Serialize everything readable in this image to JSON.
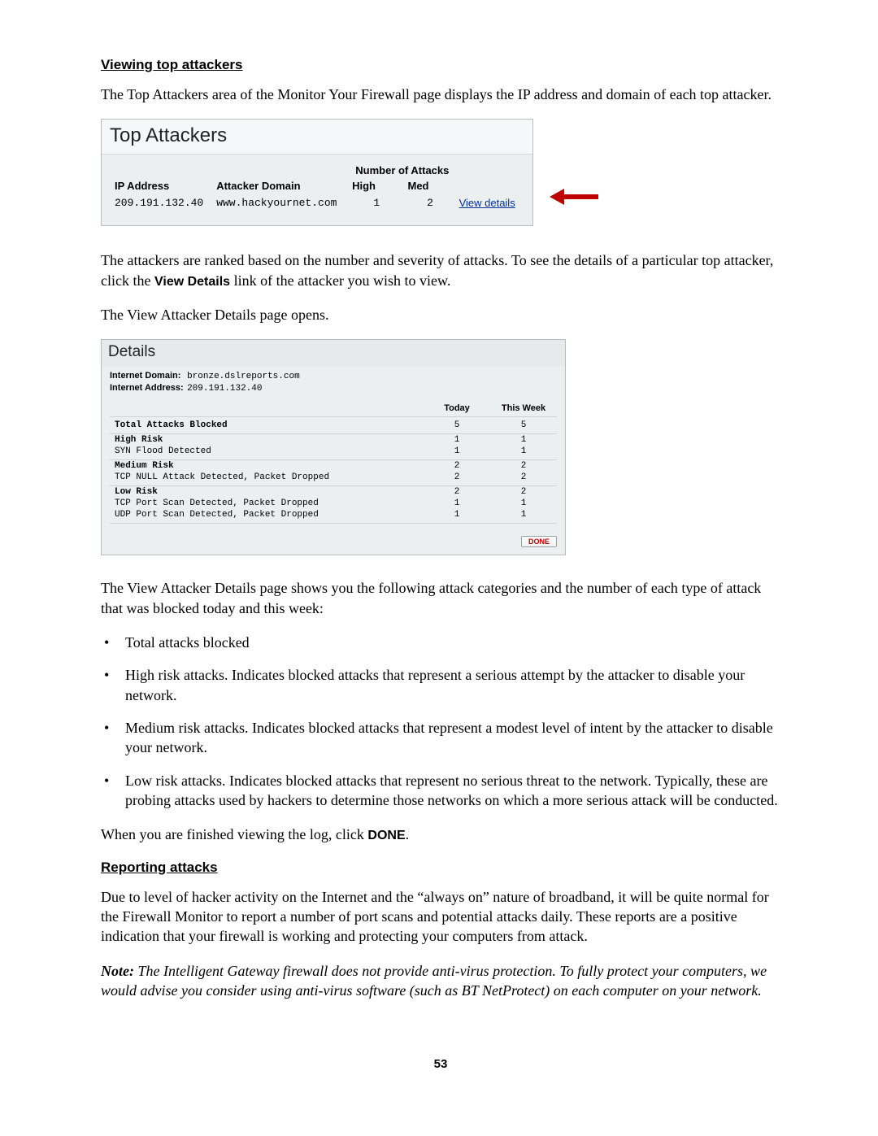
{
  "headings": {
    "viewing": "Viewing top attackers",
    "reporting": "Reporting attacks"
  },
  "paragraphs": {
    "p1": "The Top Attackers area of the Monitor Your Firewall page displays the IP address and domain of each top attacker.",
    "p2a": "The attackers are ranked based on the number and severity of attacks. To see the details of a particular top attacker, click the ",
    "p2b_bold": "View Details",
    "p2c": " link of the attacker you wish to view.",
    "p3": "The View Attacker Details page opens.",
    "p4": "The View Attacker Details page shows you the following attack categories and the number of each type of attack that was blocked today and this week:",
    "p5a": "When you are finished viewing the log, click ",
    "p5b_bold": "DONE",
    "p5c": ".",
    "p6": "Due to level of hacker activity on the Internet and the “always on” nature of broadband, it will be quite normal for the Firewall Monitor to report a number of port scans and potential attacks daily. These reports are a positive indication that your firewall is working and protecting your computers from attack.",
    "note_lead": "Note:",
    "note_body": " The Intelligent Gateway firewall does not provide anti-virus protection. To fully protect your computers, we would advise you consider using anti-virus software (such as BT NetProtect) on each computer on your network."
  },
  "bullets": {
    "b1": "Total attacks blocked",
    "b2": "High risk attacks. Indicates blocked attacks that represent a serious attempt by the attacker to disable your network.",
    "b3": "Medium risk attacks. Indicates blocked attacks that represent a modest level of intent by the attacker to disable your network.",
    "b4": "Low risk attacks. Indicates blocked attacks that represent no serious threat to the network. Typically, these are probing attacks used by hackers to determine those networks on which a more serious attack will be conducted."
  },
  "top_attackers": {
    "title": "Top Attackers",
    "group_header": "Number of Attacks",
    "cols": {
      "ip": "IP Address",
      "domain": "Attacker Domain",
      "high": "High",
      "med": "Med"
    },
    "row": {
      "ip": "209.191.132.40",
      "domain": "www.hackyournet.com",
      "high": "1",
      "med": "2",
      "link": "View details"
    }
  },
  "details": {
    "title": "Details",
    "kv_domain_label": "Internet Domain:",
    "kv_domain_value": "bronze.dslreports.com",
    "kv_addr_label": "Internet Address:",
    "kv_addr_value": "209.191.132.40",
    "cols": {
      "today": "Today",
      "week": "This Week"
    },
    "rows": {
      "total": {
        "label": "Total Attacks Blocked",
        "today": "5",
        "week": "5"
      },
      "high": {
        "label": "High Risk",
        "today": "1",
        "week": "1"
      },
      "high1": {
        "label": "SYN Flood Detected",
        "today": "1",
        "week": "1"
      },
      "med": {
        "label": "Medium Risk",
        "today": "2",
        "week": "2"
      },
      "med1": {
        "label": "TCP NULL Attack Detected, Packet Dropped",
        "today": "2",
        "week": "2"
      },
      "low": {
        "label": "Low Risk",
        "today": "2",
        "week": "2"
      },
      "low1": {
        "label": "TCP Port Scan Detected, Packet Dropped",
        "today": "1",
        "week": "1"
      },
      "low2": {
        "label": "UDP Port Scan Detected, Packet Dropped",
        "today": "1",
        "week": "1"
      }
    },
    "done": "DONE"
  },
  "page_number": "53"
}
